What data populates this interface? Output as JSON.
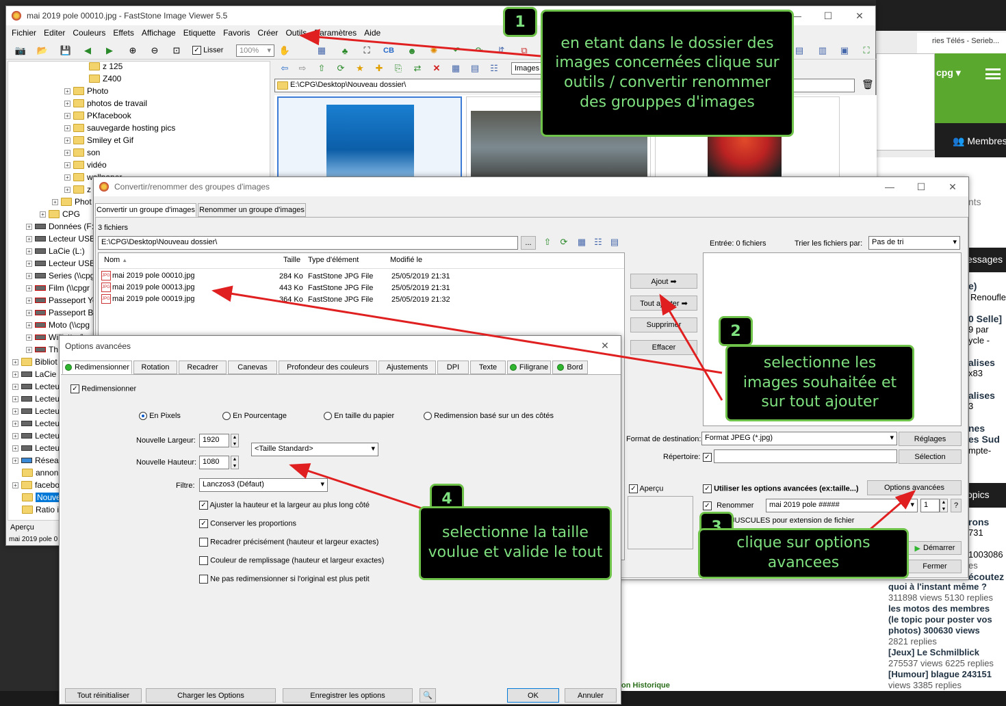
{
  "main_window": {
    "title": "mai 2019 pole 00010.jpg  -  FastStone Image Viewer 5.5",
    "menu": [
      "Fichier",
      "Editer",
      "Couleurs",
      "Effets",
      "Affichage",
      "Etiquette",
      "Favoris",
      "Créer",
      "Outils",
      "Paramètres",
      "Aide"
    ],
    "toolbar": {
      "smooth_label": "Lisser",
      "zoom_value": "100%",
      "images_filter": "Images"
    },
    "path": "E:\\CPG\\Desktop\\Nouveau dossier\\",
    "preview_label": "Aperçu",
    "status_file": "mai 2019 pole 0",
    "tree": [
      "z 125",
      "Z400",
      "Photo",
      "photos de travail",
      "PKfacebook",
      "sauvegarde hosting pics",
      "Smiley et Gif",
      "son",
      "vidéo",
      "wallpaper",
      "z",
      "Phot",
      "CPG",
      "Données (F:",
      "Lecteur USB",
      "LaCie (L:)",
      "Lecteur USB",
      "Series (\\\\cpg",
      "Film (\\\\cpgr",
      "Passeport Ye",
      "Passeport Bl",
      "Moto (\\\\cpg",
      "Willistte (\\",
      "Th",
      "Bibliot",
      "LaCie",
      "Lecteu",
      "Lecteu",
      "Lecteu",
      "Lecteu",
      "Lecteu",
      "Lecteu",
      "Réseau",
      "annon",
      "facebo",
      "Nouve",
      "Ratio i"
    ]
  },
  "convert_dialog": {
    "title": "Convertir/renommer des groupes d'images",
    "tabs": [
      "Convertir un groupe d'images",
      "Renommer un groupe d'images"
    ],
    "file_count": "3 fichiers",
    "source_path": "E:\\CPG\\Desktop\\Nouveau dossier\\",
    "browse_label": "...",
    "columns": [
      "Nom",
      "Taille",
      "Type d'élément",
      "Modifié le"
    ],
    "files": [
      {
        "name": "mai 2019 pole 00010.jpg",
        "size": "284 Ko",
        "type": "FastStone JPG File",
        "modified": "25/05/2019 21:31"
      },
      {
        "name": "mai 2019 pole 00013.jpg",
        "size": "443 Ko",
        "type": "FastStone JPG File",
        "modified": "25/05/2019 21:31"
      },
      {
        "name": "mai 2019 pole 00019.jpg",
        "size": "364 Ko",
        "type": "FastStone JPG File",
        "modified": "25/05/2019 21:32"
      }
    ],
    "buttons": {
      "add": "Ajout ➡",
      "add_all": "Tout ajouter ➡",
      "remove": "Supprimer",
      "clear": "Effacer"
    },
    "input_label": "Entrée:  0 fichiers",
    "sort_label": "Trier les fichiers par:",
    "sort_value": "Pas de tri",
    "dest_format_label": "Format de destination:",
    "dest_format_value": "Format JPEG (*.jpg)",
    "settings_label": "Réglages",
    "directory_label": "Répertoire:",
    "selection_label": "Sélection",
    "preview_label": "Aperçu",
    "use_advanced_label": "Utiliser les options avancées (ex:taille...)",
    "advanced_button": "Options avancées",
    "rename_label": "Renommer",
    "rename_pattern": "mai 2019 pole #####",
    "rename_start": "1",
    "rename_help": "?",
    "uppercase_label": "z MAJUSCULES pour extension de fichier",
    "start_button": "Démarrer",
    "close_button": "Fermer"
  },
  "options_dialog": {
    "title": "Options avancées",
    "tabs": [
      "Redimensionner",
      "Rotation",
      "Recadrer",
      "Canevas",
      "Profondeur des couleurs",
      "Ajustements",
      "DPI",
      "Texte",
      "Filigrane",
      "Bord"
    ],
    "resize_checkbox": "Redimensionner",
    "modes": [
      "En Pixels",
      "En Pourcentage",
      "En taille du papier",
      "Redimension basé sur un des côtés"
    ],
    "width_label": "Nouvelle Largeur:",
    "width_value": "1920",
    "height_label": "Nouvelle Hauteur:",
    "height_value": "1080",
    "standard_size": "<Taille Standard>",
    "filter_label": "Filtre:",
    "filter_value": "Lanczos3 (Défaut)",
    "options": [
      {
        "label": "Ajuster la hauteur et la largeur au plus long côté",
        "checked": true
      },
      {
        "label": "Conserver les proportions",
        "checked": true
      },
      {
        "label": "Recadrer précisément (hauteur et largeur exactes)",
        "checked": false
      },
      {
        "label": "Couleur de remplissage (hauteur et largeur exactes)",
        "checked": false
      },
      {
        "label": "Ne pas redimensionner si l'original est plus petit",
        "checked": false
      }
    ],
    "buttons": {
      "reset": "Tout réinitialiser",
      "load": "Charger les Options",
      "save": "Enregistrer les options",
      "ok": "OK",
      "cancel": "Annuler"
    }
  },
  "callouts": {
    "c1": {
      "num": "1",
      "text": "en etant dans le dossier des images concernées clique sur outils / convertir renommer des grouppes d'images"
    },
    "c2": {
      "num": "2",
      "text": "selectionne les images souhaitée et sur tout ajouter"
    },
    "c3": {
      "num": "3",
      "text": "clique sur options avancees"
    },
    "c4": {
      "num": "4",
      "text": "selectionne la taille voulue et valide le tout"
    }
  },
  "background_site": {
    "tab_text": "ries Télés - Serieb...",
    "user": "cpg ▾",
    "members": "Membres",
    "snippets": [
      "nts",
      "essages",
      "e)",
      "Renoufle",
      "0 Selle]",
      "9 par",
      "ycle -",
      "alises",
      "x83",
      "alises",
      "3",
      "nes",
      "es Sud",
      "mpte-",
      "opics",
      "rons",
      "731",
      "1003086",
      "écoutez",
      "es"
    ],
    "topics": [
      "quoi à l'instant même ?",
      "311898 views 5130 replies",
      "les motos des membres",
      "(le topic pour poster vos",
      "photos) 300630 views",
      "2821 replies",
      "[Jeux] Le Schmilblick",
      "275537 views 6225 replies",
      "[Humour] blague 243151",
      "views 3385 replies"
    ],
    "history": "on Historique"
  },
  "colors": {
    "callout_border": "#6fc24a",
    "callout_text": "#7fe07f",
    "arrow": "#e02020",
    "site_green": "#5aa82e"
  }
}
